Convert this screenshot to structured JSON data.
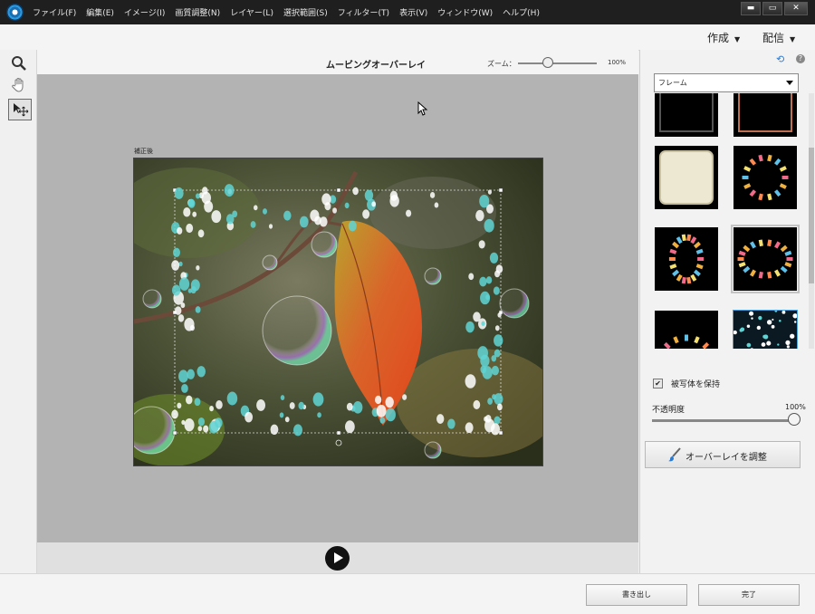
{
  "menu": {
    "items": [
      "ファイル(F)",
      "編集(E)",
      "イメージ(I)",
      "画質調整(N)",
      "レイヤー(L)",
      "選択範囲(S)",
      "フィルター(T)",
      "表示(V)",
      "ウィンドウ(W)",
      "ヘルプ(H)"
    ]
  },
  "window_buttons": {
    "minimize": "▬",
    "maximize": "▭",
    "close": "✕"
  },
  "actions": {
    "create": "作成",
    "share": "配信"
  },
  "header": {
    "title": "ムービングオーバーレイ",
    "zoom_label": "ズーム：",
    "zoom_value": "100%",
    "zoom_fraction": 0.37
  },
  "canvas": {
    "image_label": "補正後"
  },
  "tools": [
    "zoom-icon",
    "hand-icon",
    "move-icon"
  ],
  "right_panel": {
    "category": "フレーム",
    "keep_subject_label": "被写体を保持",
    "keep_subject_checked": true,
    "opacity_label": "不透明度",
    "opacity_value": "100%",
    "opacity_fraction": 1.0,
    "adjust_button": "オーバーレイを調整"
  },
  "footer": {
    "export": "書き出し",
    "done": "完了"
  },
  "colors": {
    "accent": "#2a7ad1",
    "selection": "#4aa3df"
  }
}
